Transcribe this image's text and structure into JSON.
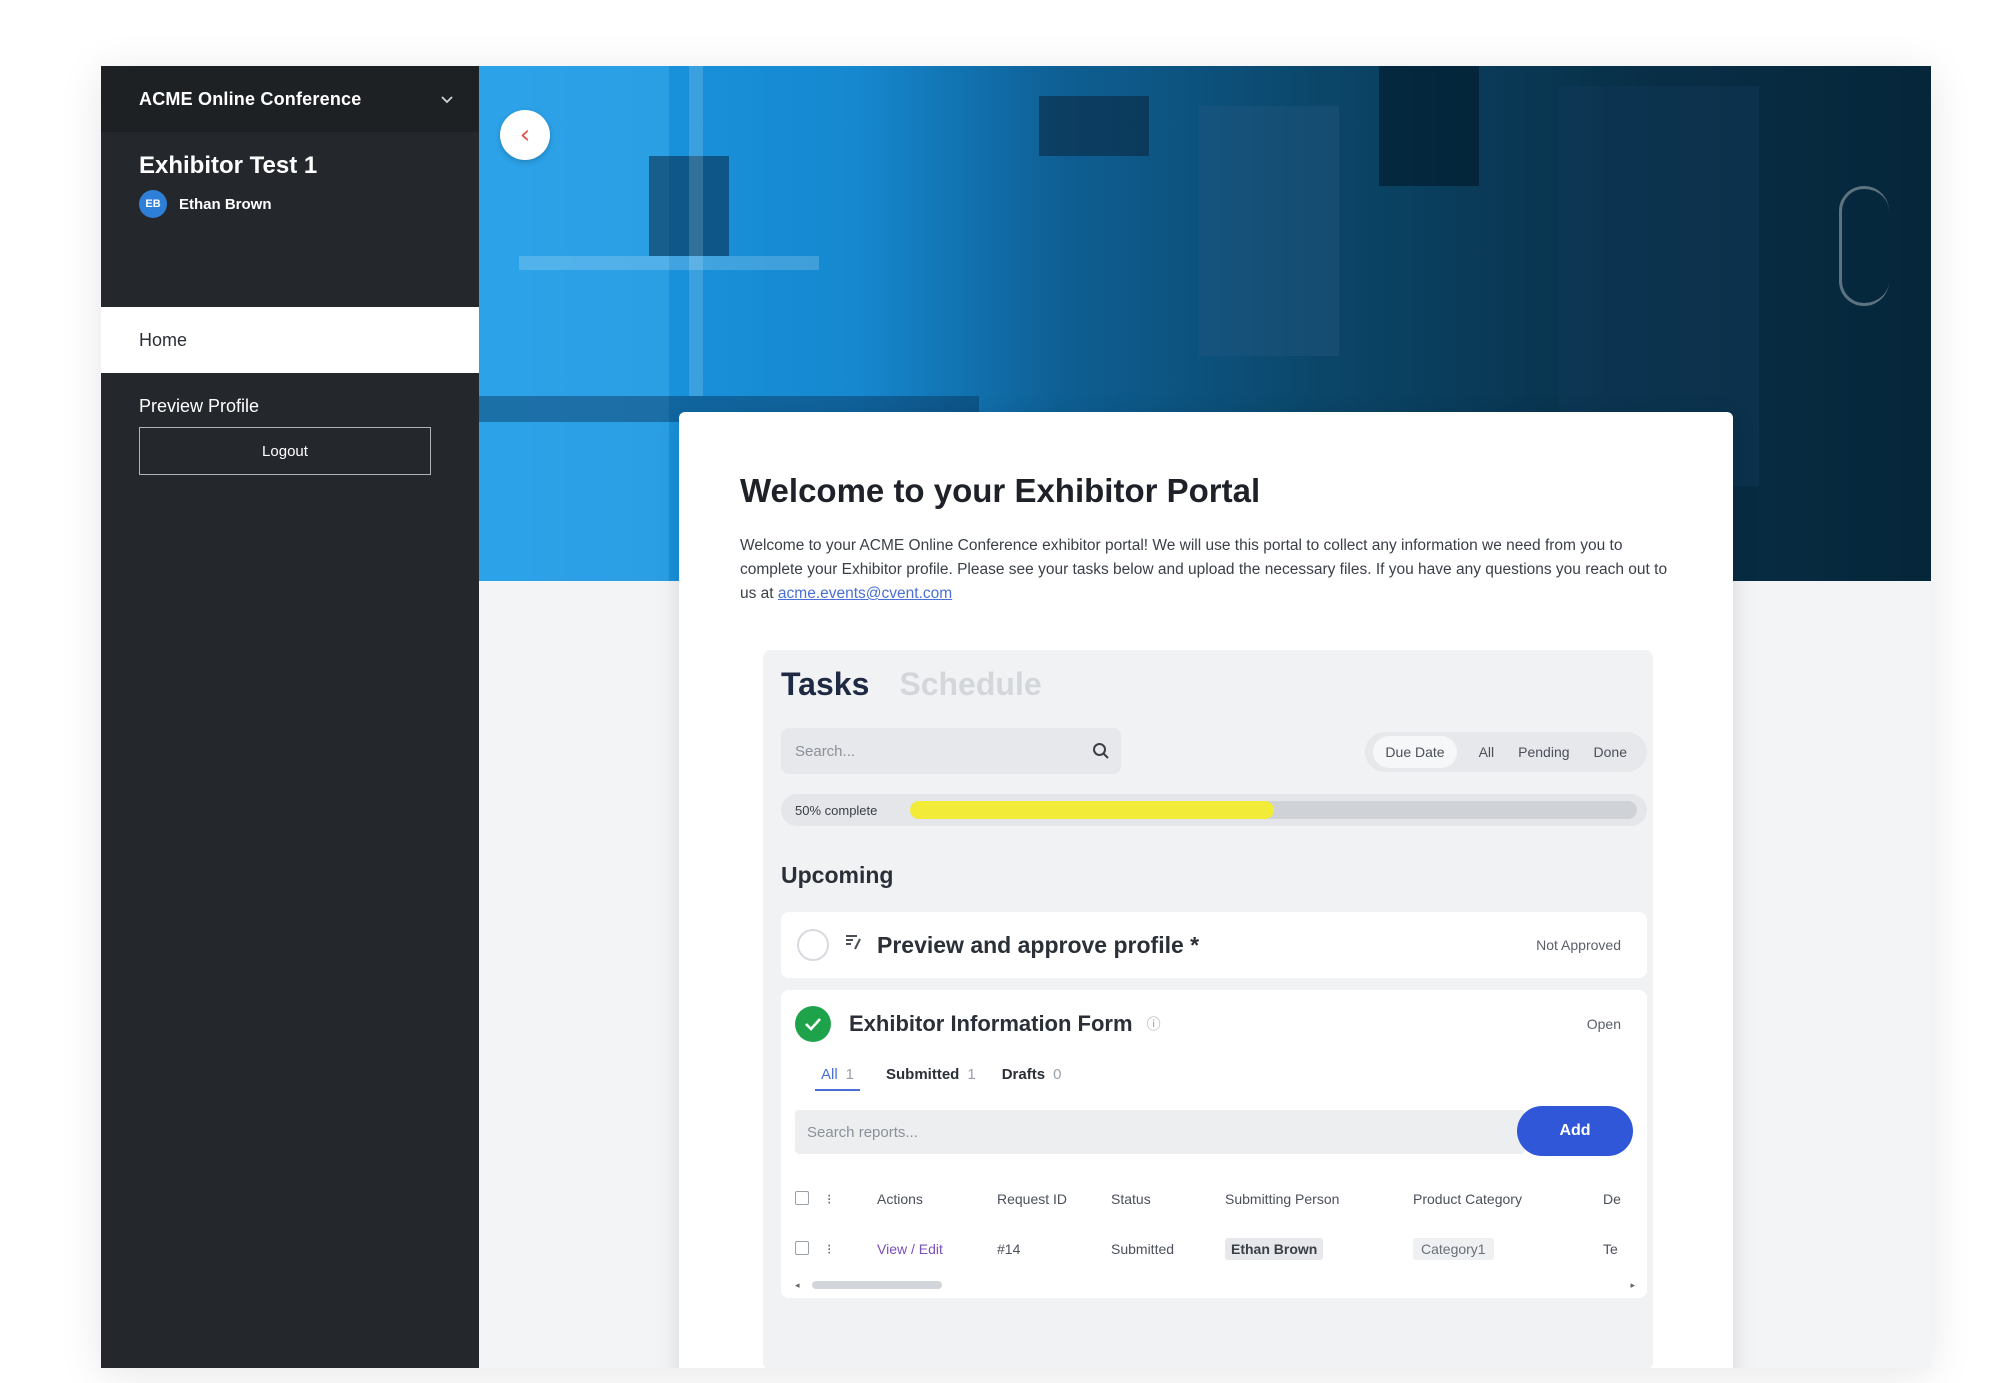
{
  "sidebar": {
    "conference_name": "ACME Online Conference",
    "exhibitor_name": "Exhibitor Test 1",
    "user": {
      "initials": "EB",
      "name": "Ethan Brown"
    },
    "nav": [
      {
        "label": "Home",
        "active": true
      },
      {
        "label": "Preview Profile",
        "active": false
      }
    ],
    "logout_label": "Logout"
  },
  "hero": {
    "back_icon": "chevron-left-icon"
  },
  "card": {
    "title": "Welcome to your Exhibitor Portal",
    "intro_text": "Welcome to your ACME Online Conference exhibitor portal! We will use this portal to collect any information we need from you to complete your Exhibitor profile. Please see your tasks below and upload the necessary files. If you have any questions you reach out to us at",
    "intro_email": "acme.events@cvent.com"
  },
  "tasks": {
    "tabs": [
      {
        "label": "Tasks",
        "active": true
      },
      {
        "label": "Schedule",
        "active": false
      }
    ],
    "search_placeholder": "Search...",
    "filters": [
      "Due Date",
      "All",
      "Pending",
      "Done"
    ],
    "progress": {
      "label": "50% complete",
      "percent": 50
    },
    "section_heading": "Upcoming",
    "items": [
      {
        "title": "Preview and approve profile *",
        "status": "Not Approved",
        "completed": false
      }
    ],
    "form": {
      "title": "Exhibitor Information Form",
      "status": "Open",
      "completed": true,
      "subtabs": [
        {
          "label": "All",
          "count": "1",
          "active": true
        },
        {
          "label": "Submitted",
          "count": "1",
          "active": false
        },
        {
          "label": "Drafts",
          "count": "0",
          "active": false
        }
      ],
      "search_placeholder": "Search reports...",
      "add_label": "Add",
      "table": {
        "columns": [
          "Actions",
          "Request ID",
          "Status",
          "Submitting Person",
          "Product Category",
          "De"
        ],
        "rows": [
          {
            "actions": "View / Edit",
            "request_id": "#14",
            "status": "Submitted",
            "person": "Ethan Brown",
            "category": "Category1",
            "more": "Te"
          }
        ]
      }
    }
  },
  "colors": {
    "sidebar_bg": "#24272b",
    "accent_blue": "#2f57d8",
    "progress_fill": "#f2ec38",
    "done_green": "#1fa34a"
  }
}
